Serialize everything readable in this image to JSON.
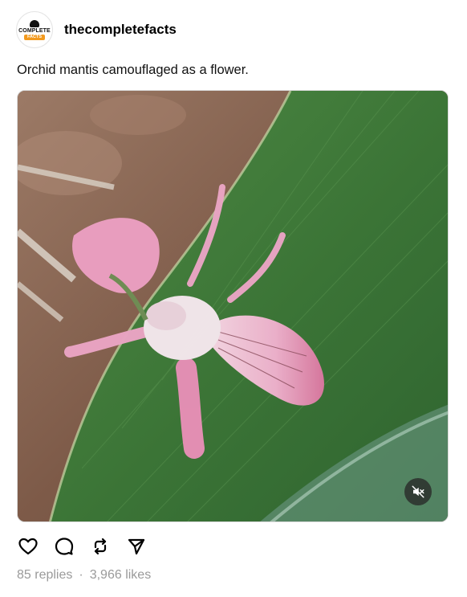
{
  "post": {
    "avatar": {
      "line1": "COMPLETE",
      "line2": "FACTS"
    },
    "username": "thecompletefacts",
    "caption": "Orchid mantis camouflaged as a flower."
  },
  "media": {
    "type": "video",
    "mute_icon": "speaker-muted-icon",
    "colors": {
      "leaf": "#3f7a3a",
      "soil": "#8a6a58",
      "mantis": "#e58fb5"
    }
  },
  "actions": [
    {
      "name": "like",
      "icon": "heart-icon"
    },
    {
      "name": "reply",
      "icon": "comment-bubble-icon"
    },
    {
      "name": "repost",
      "icon": "repost-icon"
    },
    {
      "name": "share",
      "icon": "send-icon"
    }
  ],
  "stats": {
    "replies": "85 replies",
    "separator": "·",
    "likes": "3,966 likes"
  }
}
